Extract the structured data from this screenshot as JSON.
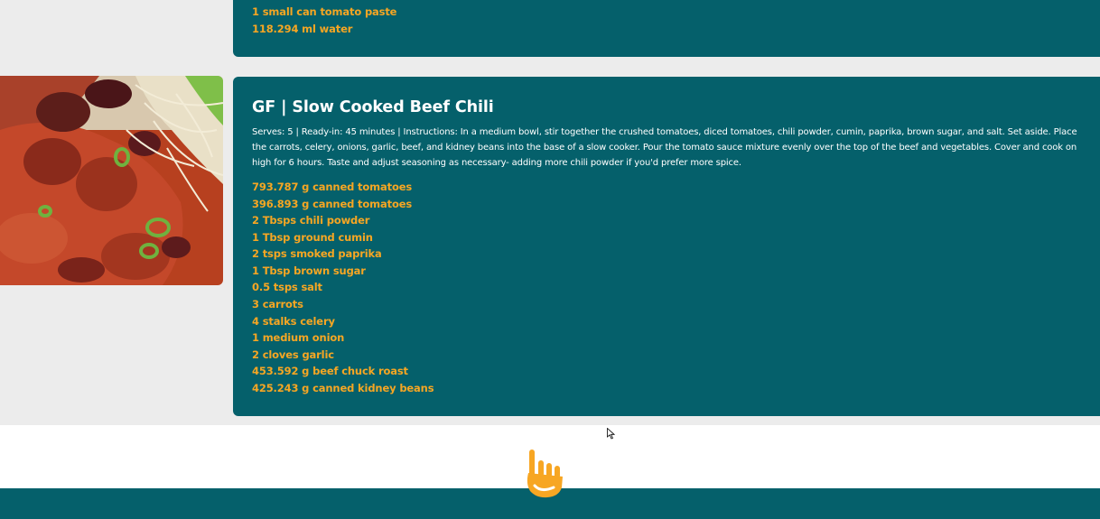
{
  "prev_recipe": {
    "ingredients": [
      "1 small can tomato paste",
      "118.294 ml water"
    ]
  },
  "recipe": {
    "title": "GF | Slow Cooked Beef Chili",
    "description": "Serves: 5 | Ready-in: 45 minutes | Instructions: In a medium bowl, stir together the crushed tomatoes, diced tomatoes, chili powder, cumin, paprika, brown sugar, and salt. Set aside. Place the carrots, celery, onions, garlic, beef, and kidney beans into the base of a slow cooker. Pour the tomato sauce mixture evenly over the top of the beef and vegetables. Cover and cook on high for 6 hours. Taste and adjust seasoning as necessary- adding more chili powder if you'd prefer more spice.",
    "ingredients": [
      "793.787 g canned tomatoes",
      "396.893 g canned tomatoes",
      "2 Tbsps chili powder",
      "1 Tbsp ground cumin",
      "2 tsps smoked paprika",
      "1 Tbsp brown sugar",
      "0.5 tsps salt",
      "3 carrots",
      "4 stalks celery",
      "1 medium onion",
      "2 cloves garlic",
      "453.592 g beef chuck roast",
      "425.243 g canned kidney beans"
    ],
    "image": "beef-chili-photo"
  },
  "footer": {
    "icon": "hand-pointing-up-icon"
  },
  "colors": {
    "card": "#05606b",
    "ingredient": "#f6a623",
    "page_background": "#ececec",
    "footer_background": "#ffffff"
  }
}
